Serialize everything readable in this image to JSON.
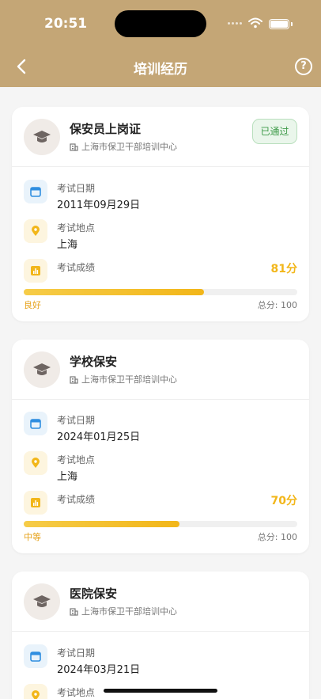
{
  "status_bar": {
    "time": "20:51"
  },
  "nav": {
    "title": "培训经历",
    "help_glyph": "?"
  },
  "records": [
    {
      "name": "保安员上岗证",
      "org": "上海市保卫干部培训中心",
      "badge": "已通过",
      "date_label": "考试日期",
      "date": "2011年09月29日",
      "location_label": "考试地点",
      "location": "上海",
      "score_label": "考试成绩",
      "score": "81分",
      "score_pct": 0.66,
      "level": "良好",
      "total": "总分: 100"
    },
    {
      "name": "学校保安",
      "org": "上海市保卫干部培训中心",
      "date_label": "考试日期",
      "date": "2024年01月25日",
      "location_label": "考试地点",
      "location": "上海",
      "score_label": "考试成绩",
      "score": "70分",
      "score_pct": 0.57,
      "level": "中等",
      "total": "总分: 100"
    },
    {
      "name": "医院保安",
      "org": "上海市保卫干部培训中心",
      "date_label": "考试日期",
      "date": "2024年03月21日",
      "location_label": "考试地点"
    }
  ],
  "colors": {
    "header_bg": "#c4a676",
    "score": "#f2b619",
    "passed": "#3d9a48"
  },
  "icons": [
    "back-arrow-icon",
    "help-icon",
    "graduation-cap-icon",
    "building-icon",
    "calendar-icon",
    "location-pin-icon",
    "chart-icon"
  ]
}
